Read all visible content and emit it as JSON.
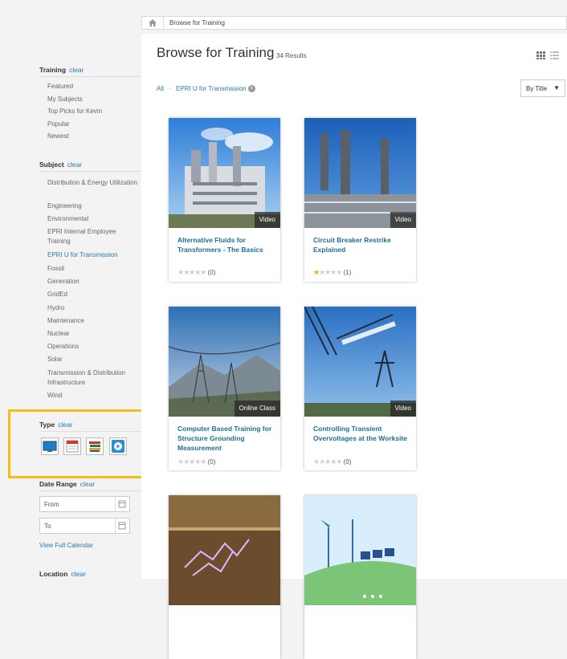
{
  "breadcrumb": {
    "text": "Browse for Training"
  },
  "sidebar": {
    "training": {
      "title": "Training",
      "clear": "clear",
      "items": [
        "Featured",
        "My Subjects",
        "Top Picks for Kevin",
        "Popular",
        "Newest"
      ]
    },
    "subject": {
      "title": "Subject",
      "clear": "clear",
      "items": [
        "Distribution & Energy Utilization",
        "Engineering",
        "Environmental",
        "EPRI Internal Employee Training",
        "EPRI U for Transmission",
        "Fossil",
        "Generation",
        "GridEd",
        "Hydro",
        "Maintenance",
        "Nuclear",
        "Operations",
        "Solar",
        "Transmission & Distribution Infrastructure",
        "Wind"
      ],
      "active_index": 4
    },
    "type": {
      "title": "Type",
      "clear": "clear",
      "icons": [
        "monitor-icon",
        "calendar-class-icon",
        "books-icon",
        "video-play-icon"
      ]
    },
    "date_range": {
      "title": "Date Range",
      "clear": "clear",
      "from_placeholder": "From",
      "to_placeholder": "To",
      "calendar_link": "View Full Calendar"
    },
    "location": {
      "title": "Location",
      "clear": "clear"
    }
  },
  "main": {
    "title": "Browse for Training",
    "results": "34 Results",
    "filter": {
      "all": "All",
      "separator": "-",
      "active": "EPRI U for Transmission"
    },
    "sort": {
      "selected": "By Title"
    },
    "accent": "#1f6f91",
    "highlight_color": "#f6bd16",
    "cards": [
      {
        "title": "Alternative Fluids for Transformers - The Basics",
        "badge": "Video",
        "stars": 0,
        "count": "(0)"
      },
      {
        "title": "Circuit Breaker Restrike Explained",
        "badge": "Video",
        "stars": 1,
        "count": "(1)"
      },
      {
        "title": "Computer Based Training for Structure Grounding Measurement",
        "badge": "Online Class",
        "stars": 0,
        "count": "(0)"
      },
      {
        "title": "Controlling Transient Overvoltages at the Worksite",
        "badge": "Video",
        "stars": 0,
        "count": "(0)"
      },
      {
        "title": "",
        "badge": "",
        "stars": 0,
        "count": ""
      },
      {
        "title": "",
        "badge": "",
        "stars": 0,
        "count": ""
      }
    ]
  }
}
